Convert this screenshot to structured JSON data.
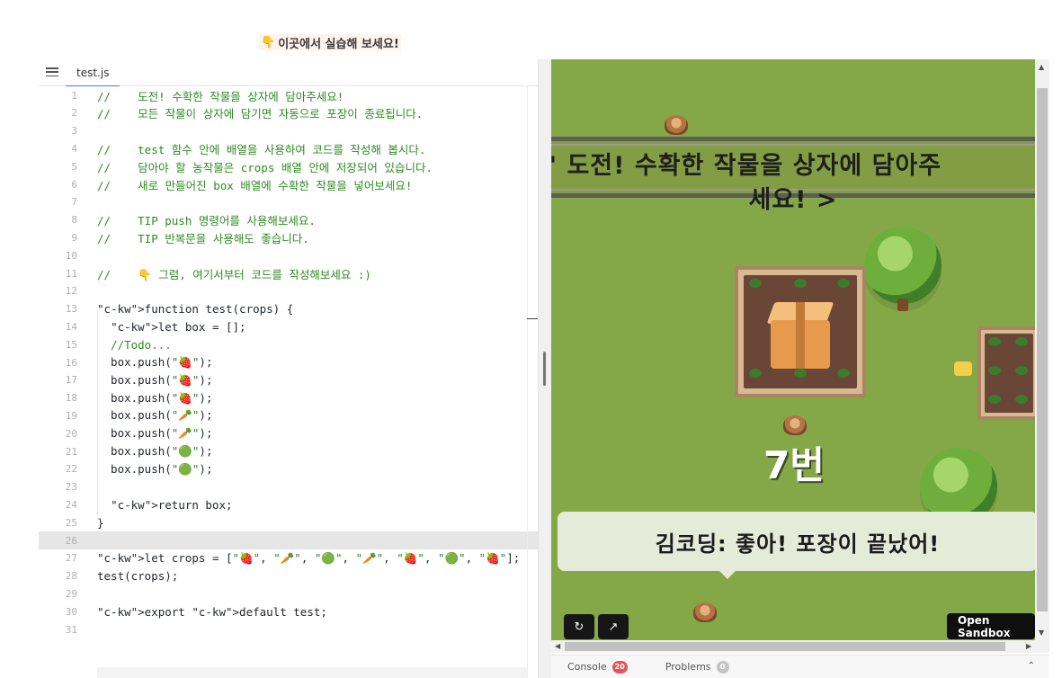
{
  "banner": {
    "hand": "👇",
    "text": "이곳에서 실습해 보세요!"
  },
  "editor": {
    "tab": "test.js",
    "lines": [
      {
        "n": "1",
        "t": "//    도전! 수확한 작물을 상자에 담아주세요!",
        "k": "c-com"
      },
      {
        "n": "2",
        "t": "//    모든 작물이 상자에 담기면 자동으로 포장이 종료됩니다.",
        "k": "c-com"
      },
      {
        "n": "3",
        "t": "",
        "k": "txt"
      },
      {
        "n": "4",
        "t": "//    test 함수 안에 배열을 사용하여 코드를 작성해 봅시다.",
        "k": "c-com"
      },
      {
        "n": "5",
        "t": "//    담아야 할 농작물은 crops 배열 안에 저장되어 있습니다.",
        "k": "c-com"
      },
      {
        "n": "6",
        "t": "//    새로 만들어진 box 배열에 수확한 작물을 넣어보세요!",
        "k": "c-com"
      },
      {
        "n": "7",
        "t": "",
        "k": "txt"
      },
      {
        "n": "8",
        "t": "//    TIP push 명령어를 사용해보세요.",
        "k": "c-com"
      },
      {
        "n": "9",
        "t": "//    TIP 반복문을 사용해도 좋습니다.",
        "k": "c-com"
      },
      {
        "n": "10",
        "t": "",
        "k": "txt"
      },
      {
        "n": "11",
        "t": "//    👇 그럼, 여기서부터 코드를 작성해보세요 :)",
        "k": "c-com"
      },
      {
        "n": "12",
        "t": "",
        "k": "txt"
      },
      {
        "n": "13",
        "t": "function test(crops) {",
        "k": "txt"
      },
      {
        "n": "14",
        "t": "  let box = [];",
        "k": "txt"
      },
      {
        "n": "15",
        "t": "  //Todo...",
        "k": "c-com"
      },
      {
        "n": "16",
        "t": "  box.push(\"🍓\");",
        "k": "txt"
      },
      {
        "n": "17",
        "t": "  box.push(\"🍓\");",
        "k": "txt"
      },
      {
        "n": "18",
        "t": "  box.push(\"🍓\");",
        "k": "txt"
      },
      {
        "n": "19",
        "t": "  box.push(\"🥕\");",
        "k": "txt"
      },
      {
        "n": "20",
        "t": "  box.push(\"🥕\");",
        "k": "txt"
      },
      {
        "n": "21",
        "t": "  box.push(\"🟢\");",
        "k": "txt"
      },
      {
        "n": "22",
        "t": "  box.push(\"🟢\");",
        "k": "txt"
      },
      {
        "n": "23",
        "t": "",
        "k": "txt"
      },
      {
        "n": "24",
        "t": "  return box;",
        "k": "txt"
      },
      {
        "n": "25",
        "t": "}",
        "k": "txt"
      },
      {
        "n": "26",
        "t": "",
        "k": "txt"
      },
      {
        "n": "27",
        "t": "let crops = [\"🍓\", \"🥕\", \"🟢\", \"🥕\", \"🍓\", \"🟢\", \"🍓\"];",
        "k": "txt"
      },
      {
        "n": "28",
        "t": "test(crops);",
        "k": "txt"
      },
      {
        "n": "29",
        "t": "",
        "k": "txt"
      },
      {
        "n": "30",
        "t": "export default test;",
        "k": "txt"
      },
      {
        "n": "31",
        "t": "",
        "k": "txt"
      }
    ],
    "active_line": "26"
  },
  "preview": {
    "title_line1": "\" 도전! 수확한 작물을 상자에 담아주",
    "title_line2": "세요! >",
    "crate_number": "7번",
    "dialog": "김코딩: 좋아! 포장이 끝났어!",
    "refresh_icon": "↻",
    "open_new_icon": "↗",
    "open_sandbox": "Open Sandbox"
  },
  "console_bar": {
    "console_label": "Console",
    "console_count": "20",
    "problems_label": "Problems",
    "problems_count": "0",
    "chevron": "⌃"
  }
}
